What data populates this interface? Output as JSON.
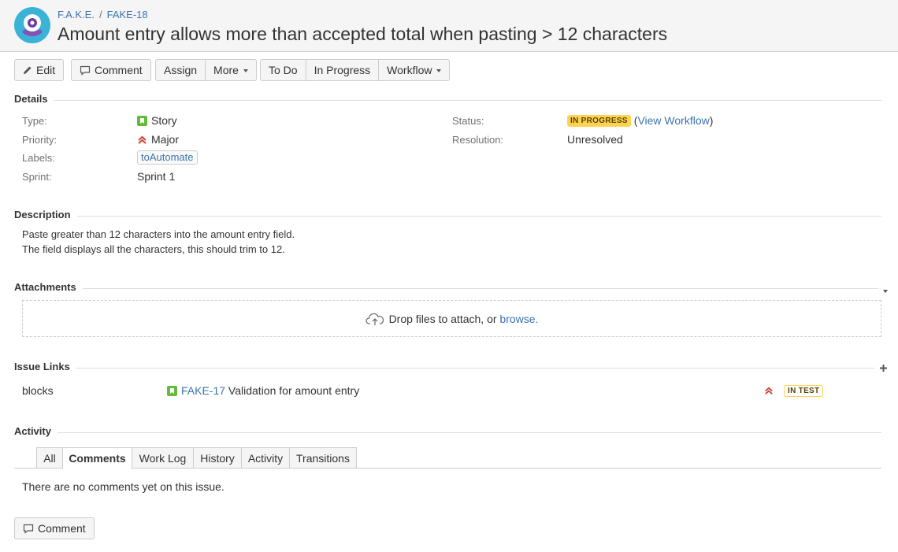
{
  "header": {
    "breadcrumb": {
      "project": "F.A.K.E.",
      "separator": "/",
      "issue_key": "FAKE-18"
    },
    "title": "Amount entry allows more than accepted total when pasting > 12 characters"
  },
  "toolbar": {
    "edit": "Edit",
    "comment": "Comment",
    "assign": "Assign",
    "more": "More",
    "todo": "To Do",
    "in_progress": "In Progress",
    "workflow": "Workflow"
  },
  "details": {
    "heading": "Details",
    "type_label": "Type:",
    "type_value": "Story",
    "priority_label": "Priority:",
    "priority_value": "Major",
    "labels_label": "Labels:",
    "labels_value": "toAutomate",
    "sprint_label": "Sprint:",
    "sprint_value": "Sprint 1",
    "status_label": "Status:",
    "status_value": "IN PROGRESS",
    "view_workflow_open": "(",
    "view_workflow": "View Workflow",
    "view_workflow_close": ")",
    "resolution_label": "Resolution:",
    "resolution_value": "Unresolved"
  },
  "description": {
    "heading": "Description",
    "line1": "Paste greater than 12 characters into the amount entry field.",
    "line2": "The field displays all the characters, this should trim to 12."
  },
  "attachments": {
    "heading": "Attachments",
    "drop_text": "Drop files to attach, or",
    "browse": "browse."
  },
  "issue_links": {
    "heading": "Issue Links",
    "relation": "blocks",
    "key": "FAKE-17",
    "summary": "Validation for amount entry",
    "status": "IN TEST"
  },
  "activity": {
    "heading": "Activity",
    "tabs": [
      "All",
      "Comments",
      "Work Log",
      "History",
      "Activity",
      "Transitions"
    ],
    "empty": "There are no comments yet on this issue.",
    "comment_button": "Comment"
  },
  "colors": {
    "link": "#3b73af",
    "story_icon": "#63ba3c",
    "priority_major": "#d04437",
    "status_in_progress": "#ffd351"
  }
}
